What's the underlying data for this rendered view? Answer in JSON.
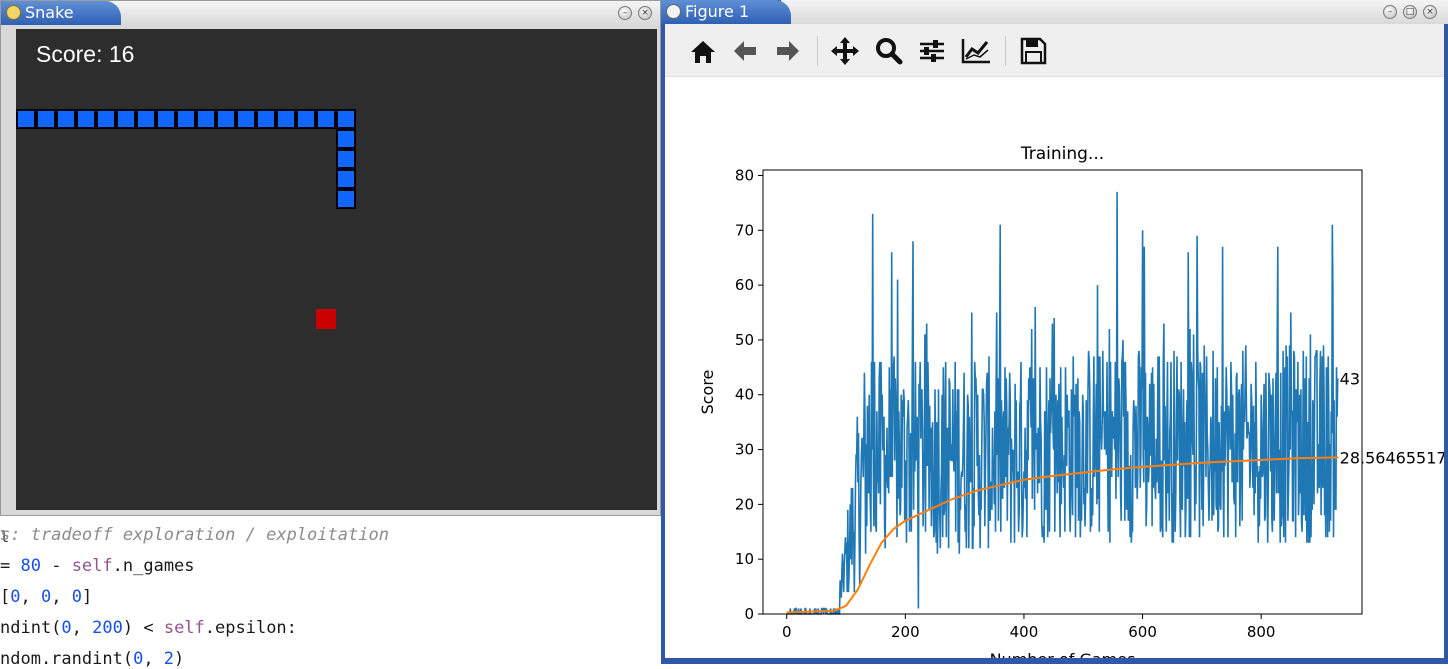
{
  "editor": {
    "edge_chars": [
      "m",
      "e",
      "l",
      "",
      "",
      "l",
      "",
      "n",
      "t",
      "a",
      "i",
      "",
      "e",
      "t",
      "",
      "",
      "l"
    ],
    "lines": [
      {
        "parts": [
          {
            "t": "cmt",
            "v": "s: tradeoff exploration / exploitation"
          }
        ]
      },
      {
        "parts": [
          {
            "t": "plain",
            "v": "= "
          },
          {
            "t": "num",
            "v": "80"
          },
          {
            "t": "plain",
            "v": " - "
          },
          {
            "t": "slf",
            "v": "self"
          },
          {
            "t": "plain",
            "v": ".n_games"
          }
        ]
      },
      {
        "parts": [
          {
            "t": "plain",
            "v": "["
          },
          {
            "t": "num",
            "v": "0"
          },
          {
            "t": "plain",
            "v": ", "
          },
          {
            "t": "num",
            "v": "0"
          },
          {
            "t": "plain",
            "v": ", "
          },
          {
            "t": "num",
            "v": "0"
          },
          {
            "t": "plain",
            "v": "]"
          }
        ]
      },
      {
        "parts": [
          {
            "t": "plain",
            "v": "ndint("
          },
          {
            "t": "num",
            "v": "0"
          },
          {
            "t": "plain",
            "v": ", "
          },
          {
            "t": "num",
            "v": "200"
          },
          {
            "t": "plain",
            "v": ") < "
          },
          {
            "t": "slf",
            "v": "self"
          },
          {
            "t": "plain",
            "v": ".epsilon:"
          }
        ]
      },
      {
        "parts": [
          {
            "t": "plain",
            "v": "ndom.randint("
          },
          {
            "t": "num",
            "v": "0"
          },
          {
            "t": "plain",
            "v": ", "
          },
          {
            "t": "num",
            "v": "2"
          },
          {
            "t": "plain",
            "v": ")"
          }
        ]
      }
    ]
  },
  "snake_window": {
    "title": "Snake",
    "score_text": "Score: 16",
    "snake_color": "#1166ff",
    "food_color": "#c80000",
    "board_color": "#2d2d2d",
    "snake_cells": [
      [
        32,
        4
      ],
      [
        31,
        4
      ],
      [
        30,
        4
      ],
      [
        29,
        4
      ],
      [
        28,
        4
      ],
      [
        27,
        4
      ],
      [
        26,
        4
      ],
      [
        25,
        4
      ],
      [
        24,
        4
      ],
      [
        23,
        4
      ],
      [
        22,
        4
      ],
      [
        21,
        4
      ],
      [
        20,
        4
      ],
      [
        19,
        4
      ],
      [
        18,
        4
      ],
      [
        17,
        4
      ],
      [
        16,
        4
      ],
      [
        32,
        5
      ],
      [
        32,
        6
      ],
      [
        32,
        7
      ],
      [
        32,
        8
      ]
    ],
    "food_cell": [
      16,
      14
    ]
  },
  "figure_window": {
    "title": "Figure 1",
    "toolbar": [
      {
        "name": "home-button",
        "icon": "home-icon"
      },
      {
        "name": "back-button",
        "icon": "arrow-left-icon"
      },
      {
        "name": "forward-button",
        "icon": "arrow-right-icon"
      },
      {
        "name": "pan-button",
        "icon": "move-icon"
      },
      {
        "name": "zoom-button",
        "icon": "magnifier-icon"
      },
      {
        "name": "configure-subplots-button",
        "icon": "sliders-icon"
      },
      {
        "name": "edit-axis-button",
        "icon": "line-chart-icon"
      },
      {
        "name": "save-button",
        "icon": "floppy-disk-icon"
      }
    ]
  },
  "chart_data": {
    "type": "line",
    "title": "Training...",
    "xlabel": "Number of Games",
    "ylabel": "Score",
    "xlim": [
      -40,
      970
    ],
    "ylim": [
      0,
      81
    ],
    "xticks": [
      0,
      200,
      400,
      600,
      800
    ],
    "yticks": [
      0,
      10,
      20,
      30,
      40,
      50,
      60,
      70,
      80
    ],
    "n_games": 930,
    "series": [
      {
        "color": "#1f77b4",
        "summary": {
          "early_phase_end": 90,
          "early_max": 2,
          "spikes": [
            [
              145,
              73
            ],
            [
              213,
              68
            ],
            [
              222,
              1
            ],
            [
              557,
              77
            ],
            [
              600,
              70
            ],
            [
              735,
              67
            ],
            [
              850,
              55
            ]
          ]
        },
        "last_label": "43"
      },
      {
        "color": "#ff7f0e",
        "x": [
          0,
          80,
          100,
          120,
          140,
          160,
          180,
          200,
          220,
          250,
          280,
          320,
          360,
          400,
          450,
          500,
          560,
          620,
          700,
          780,
          860,
          930
        ],
        "y": [
          0.3,
          0.6,
          1.5,
          4.5,
          9,
          13,
          15.5,
          17,
          18,
          19.5,
          21,
          22.5,
          23.5,
          24.5,
          25.2,
          25.8,
          26.5,
          27,
          27.6,
          28,
          28.4,
          28.56
        ],
        "last_label": "28.56465517"
      }
    ]
  }
}
